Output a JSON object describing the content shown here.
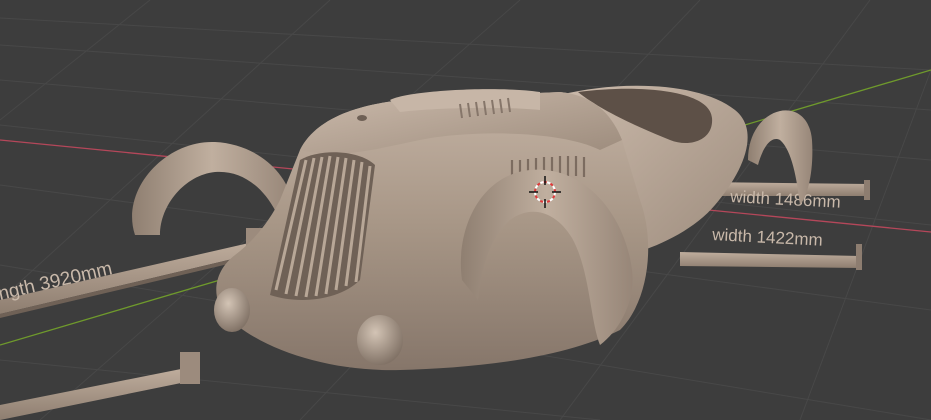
{
  "viewport": {
    "name": "3D Viewport",
    "background": "#3d3d3d",
    "grid_color": "#484848",
    "axis_x_color": "#b5475a",
    "axis_y_color": "#6f9a2c"
  },
  "model": {
    "name": "streamlined car body",
    "material_color": "#b4a394"
  },
  "dimensions": {
    "length_label": "ngth 3920mm",
    "width_label_1": "width 1486mm",
    "width_label_2": "width 1422mm"
  },
  "cursor": {
    "name": "3D cursor"
  }
}
